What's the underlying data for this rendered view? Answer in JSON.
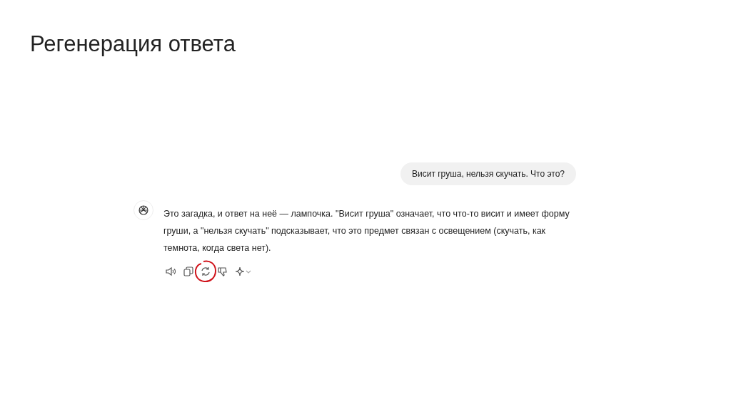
{
  "slide_title": "Регенерация ответа",
  "user_message": "Висит груша, нельзя скучать. Что это?",
  "assistant_message": "Это загадка, и ответ на неё — лампочка. \"Висит груша\" означает, что что-то висит и имеет форму груши, а \"нельзя скучать\" подсказывает, что это предмет связан с освещением (скучать, как темнота, когда света нет).",
  "actions": [
    {
      "kind": "speaker",
      "highlighted": false
    },
    {
      "kind": "copy",
      "highlighted": false
    },
    {
      "kind": "regenerate",
      "highlighted": true
    },
    {
      "kind": "dislike",
      "highlighted": false
    },
    {
      "kind": "sparkle",
      "highlighted": false
    }
  ]
}
